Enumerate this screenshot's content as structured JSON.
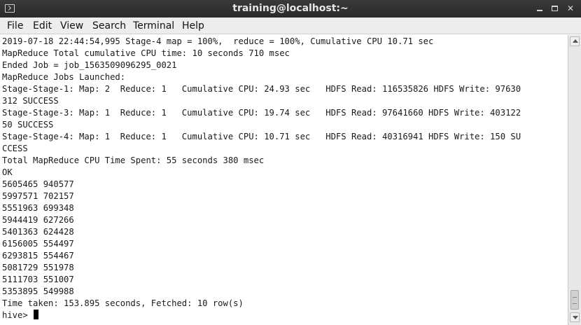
{
  "window": {
    "title": "training@localhost:~",
    "icon": "terminal-icon"
  },
  "menu": {
    "items": [
      "File",
      "Edit",
      "View",
      "Search",
      "Terminal",
      "Help"
    ]
  },
  "terminal": {
    "lines": [
      "2019-07-18 22:44:54,995 Stage-4 map = 100%,  reduce = 100%, Cumulative CPU 10.71 sec",
      "MapReduce Total cumulative CPU time: 10 seconds 710 msec",
      "Ended Job = job_1563509096295_0021",
      "MapReduce Jobs Launched:",
      "Stage-Stage-1: Map: 2  Reduce: 1   Cumulative CPU: 24.93 sec   HDFS Read: 116535826 HDFS Write: 97630",
      "312 SUCCESS",
      "Stage-Stage-3: Map: 1  Reduce: 1   Cumulative CPU: 19.74 sec   HDFS Read: 97641660 HDFS Write: 403122",
      "50 SUCCESS",
      "Stage-Stage-4: Map: 1  Reduce: 1   Cumulative CPU: 10.71 sec   HDFS Read: 40316941 HDFS Write: 150 SU",
      "CCESS",
      "Total MapReduce CPU Time Spent: 55 seconds 380 msec",
      "OK",
      "5605465 940577",
      "5997571 702157",
      "5551963 699348",
      "5944419 627266",
      "5401363 624428",
      "6156005 554497",
      "6293815 554467",
      "5081729 551978",
      "5111703 551007",
      "5353895 549988",
      "Time taken: 153.895 seconds, Fetched: 10 row(s)"
    ],
    "prompt": "hive> "
  }
}
